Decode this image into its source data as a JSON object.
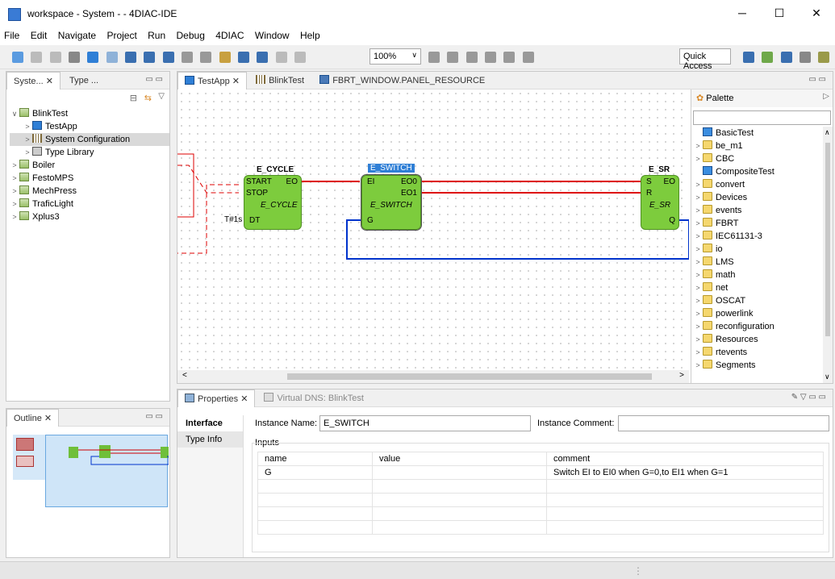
{
  "window": {
    "title": "workspace - System - - 4DIAC-IDE",
    "minimize": "─",
    "maximize": "☐",
    "close": "✕"
  },
  "menu": [
    "File",
    "Edit",
    "Navigate",
    "Project",
    "Run",
    "Debug",
    "4DIAC",
    "Window",
    "Help"
  ],
  "toolbar": {
    "zoom": "100%",
    "quick_access": "Quick Access"
  },
  "left_tabs": [
    "Syste...",
    "Type ..."
  ],
  "tree": [
    {
      "label": "BlinkTest",
      "level": 0,
      "twisty": "∨",
      "icon": "sys"
    },
    {
      "label": "TestApp",
      "level": 1,
      "twisty": ">",
      "icon": "app"
    },
    {
      "label": "System Configuration",
      "level": 1,
      "twisty": ">",
      "icon": "cfg"
    },
    {
      "label": "Type Library",
      "level": 1,
      "twisty": ">",
      "icon": "lib"
    },
    {
      "label": "Boiler",
      "level": 0,
      "twisty": ">",
      "icon": "sys"
    },
    {
      "label": "FestoMPS",
      "level": 0,
      "twisty": ">",
      "icon": "sys"
    },
    {
      "label": "MechPress",
      "level": 0,
      "twisty": ">",
      "icon": "sys"
    },
    {
      "label": "TraficLight",
      "level": 0,
      "twisty": ">",
      "icon": "sys"
    },
    {
      "label": "Xplus3",
      "level": 0,
      "twisty": ">",
      "icon": "sys"
    }
  ],
  "editor_tabs": [
    "TestApp",
    "BlinkTest",
    "FBRT_WINDOW.PANEL_RESOURCE"
  ],
  "fbs": {
    "cycle": {
      "name": "E_CYCLE",
      "type": "E_CYCLE",
      "start": "START",
      "stop": "STOP",
      "eo": "EO",
      "dt": "DT",
      "dt_value": "T#1s"
    },
    "switch": {
      "name": "E_SWITCH",
      "type": "E_SWITCH",
      "ei": "EI",
      "eo0": "EO0",
      "eo1": "EO1",
      "g": "G"
    },
    "sr": {
      "name": "E_SR",
      "type": "E_SR",
      "s": "S",
      "r": "R",
      "eo": "EO",
      "q": "Q"
    }
  },
  "palette": {
    "title": "Palette",
    "items": [
      {
        "label": "BasicTest",
        "twisty": "",
        "icon": "type"
      },
      {
        "label": "be_m1",
        "twisty": ">",
        "icon": "folder"
      },
      {
        "label": "CBC",
        "twisty": ">",
        "icon": "folder"
      },
      {
        "label": "CompositeTest",
        "twisty": "",
        "icon": "type"
      },
      {
        "label": "convert",
        "twisty": ">",
        "icon": "folder"
      },
      {
        "label": "Devices",
        "twisty": ">",
        "icon": "folder"
      },
      {
        "label": "events",
        "twisty": ">",
        "icon": "folder"
      },
      {
        "label": "FBRT",
        "twisty": ">",
        "icon": "folder"
      },
      {
        "label": "IEC61131-3",
        "twisty": ">",
        "icon": "folder"
      },
      {
        "label": "io",
        "twisty": ">",
        "icon": "folder"
      },
      {
        "label": "LMS",
        "twisty": ">",
        "icon": "folder"
      },
      {
        "label": "math",
        "twisty": ">",
        "icon": "folder"
      },
      {
        "label": "net",
        "twisty": ">",
        "icon": "folder"
      },
      {
        "label": "OSCAT",
        "twisty": ">",
        "icon": "folder"
      },
      {
        "label": "powerlink",
        "twisty": ">",
        "icon": "folder"
      },
      {
        "label": "reconfiguration",
        "twisty": ">",
        "icon": "folder"
      },
      {
        "label": "Resources",
        "twisty": ">",
        "icon": "folder"
      },
      {
        "label": "rtevents",
        "twisty": ">",
        "icon": "folder"
      },
      {
        "label": "Segments",
        "twisty": ">",
        "icon": "folder"
      }
    ]
  },
  "outline": {
    "tab": "Outline"
  },
  "properties": {
    "tabs": [
      "Properties",
      "Virtual DNS: BlinkTest"
    ],
    "side": [
      "Interface",
      "Type Info"
    ],
    "instance_name_label": "Instance Name:",
    "instance_name": "E_SWITCH",
    "instance_comment_label": "Instance Comment:",
    "instance_comment": "",
    "inputs_label": "Inputs",
    "columns": [
      "name",
      "value",
      "comment"
    ],
    "rows": [
      {
        "name": "G",
        "value": "",
        "comment": "Switch EI to EI0 when G=0,to EI1 when G=1"
      }
    ]
  }
}
